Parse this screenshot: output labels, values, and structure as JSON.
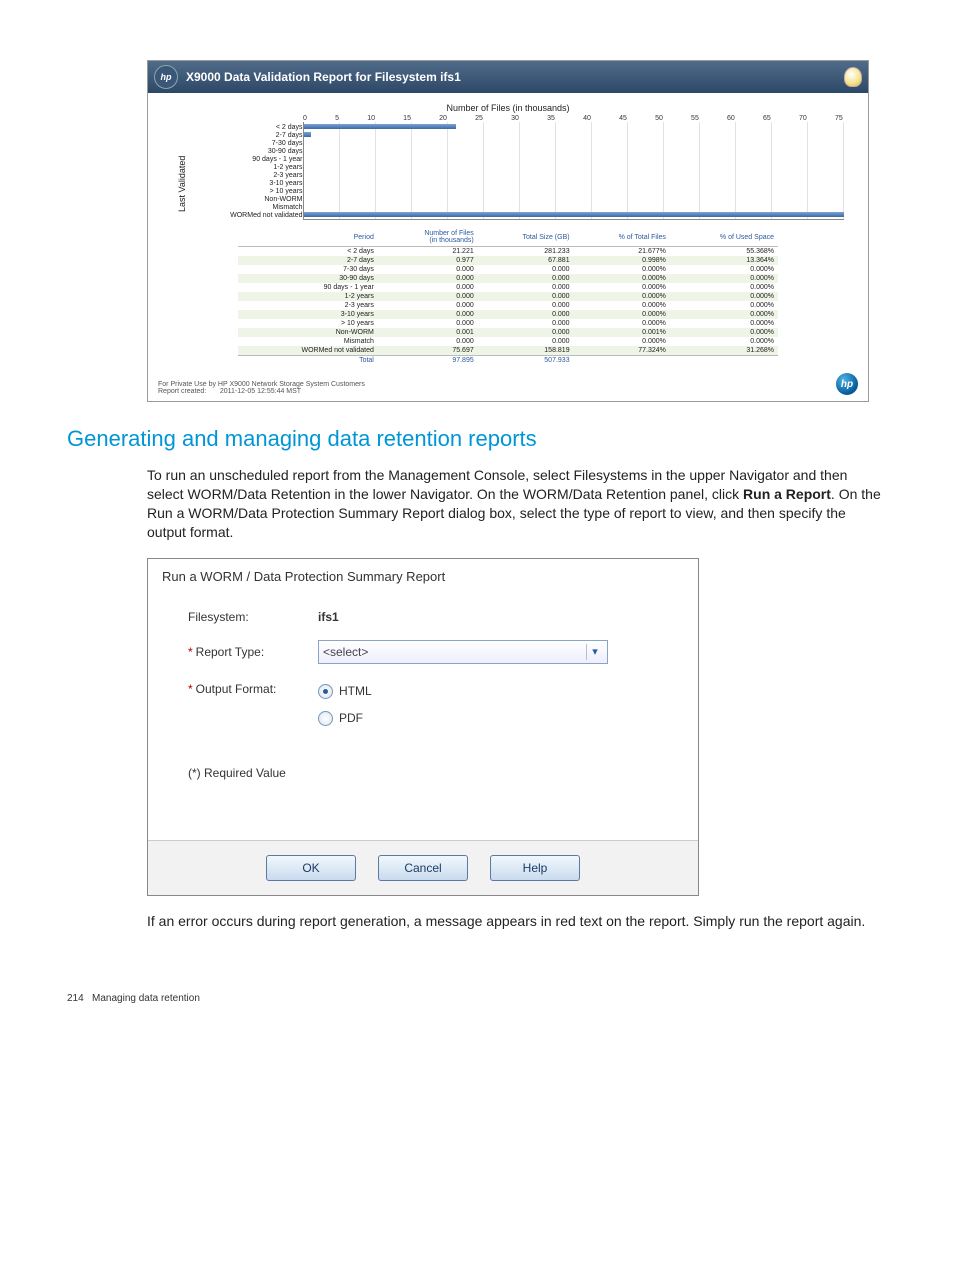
{
  "report": {
    "title": "X9000 Data Validation Report for Filesystem ifs1",
    "axis_title": "Number of Files (in thousands)",
    "y_axis_label": "Last Validated",
    "footer_note": "For Private Use by HP X9000 Network Storage System Customers",
    "created_label": "Report created:",
    "created_value": "2011-12-05  12:55:44 MST",
    "headers": {
      "period": "Period",
      "num": "Number of Files\n(in thousands)",
      "size": "Total Size (GB)",
      "pct_files": "% of Total Files",
      "pct_space": "% of Used Space"
    },
    "xticks": [
      "0",
      "5",
      "10",
      "15",
      "20",
      "25",
      "30",
      "35",
      "40",
      "45",
      "50",
      "55",
      "60",
      "65",
      "70",
      "75"
    ],
    "total_label": "Total",
    "total_num": "97.895",
    "total_size": "507.933"
  },
  "chart_data": {
    "type": "bar",
    "title": "Number of Files (in thousands)",
    "xlabel": "Number of Files (in thousands)",
    "ylabel": "Last Validated",
    "xlim": [
      0,
      75
    ],
    "categories": [
      "< 2 days",
      "2-7 days",
      "7-30 days",
      "30-90 days",
      "90 days - 1 year",
      "1-2 years",
      "2-3 years",
      "3-10 years",
      "> 10 years",
      "Non-WORM",
      "Mismatch",
      "WORMed not validated"
    ],
    "values": [
      21.221,
      0.977,
      0,
      0,
      0,
      0,
      0,
      0,
      0,
      0.001,
      0,
      75.697
    ],
    "series_meta": {
      "total_size_gb": [
        281.233,
        67.881,
        0,
        0,
        0,
        0,
        0,
        0,
        0,
        0,
        0,
        158.819
      ],
      "pct_total_files": [
        "21.677%",
        "0.998%",
        "0.000%",
        "0.000%",
        "0.000%",
        "0.000%",
        "0.000%",
        "0.000%",
        "0.000%",
        "0.001%",
        "0.000%",
        "77.324%"
      ],
      "pct_used_space": [
        "55.368%",
        "13.364%",
        "0.000%",
        "0.000%",
        "0.000%",
        "0.000%",
        "0.000%",
        "0.000%",
        "0.000%",
        "0.000%",
        "0.000%",
        "31.268%"
      ]
    }
  },
  "section": {
    "heading": "Generating and managing data retention reports",
    "para1_a": "To run an unscheduled report from the Management Console, select Filesystems in the upper Navigator and then select WORM/Data Retention in the lower Navigator. On the WORM/Data Retention panel, click ",
    "para1_bold": "Run a Report",
    "para1_b": ". On the Run a WORM/Data Protection Summary Report dialog box, select the type of report to view, and then specify the output format.",
    "para2": "If an error occurs during report generation, a message appears in red text on the report. Simply run the report again."
  },
  "dialog": {
    "title": "Run a WORM / Data Protection Summary Report",
    "filesystem_label": "Filesystem:",
    "filesystem_value": "ifs1",
    "report_type_label": "Report Type:",
    "report_type_value": "<select>",
    "output_format_label": "Output Format:",
    "opt_html": "HTML",
    "opt_pdf": "PDF",
    "required": "(*) Required Value",
    "ok": "OK",
    "cancel": "Cancel",
    "help": "Help"
  },
  "footer": {
    "page": "214",
    "chapter": "Managing data retention"
  }
}
